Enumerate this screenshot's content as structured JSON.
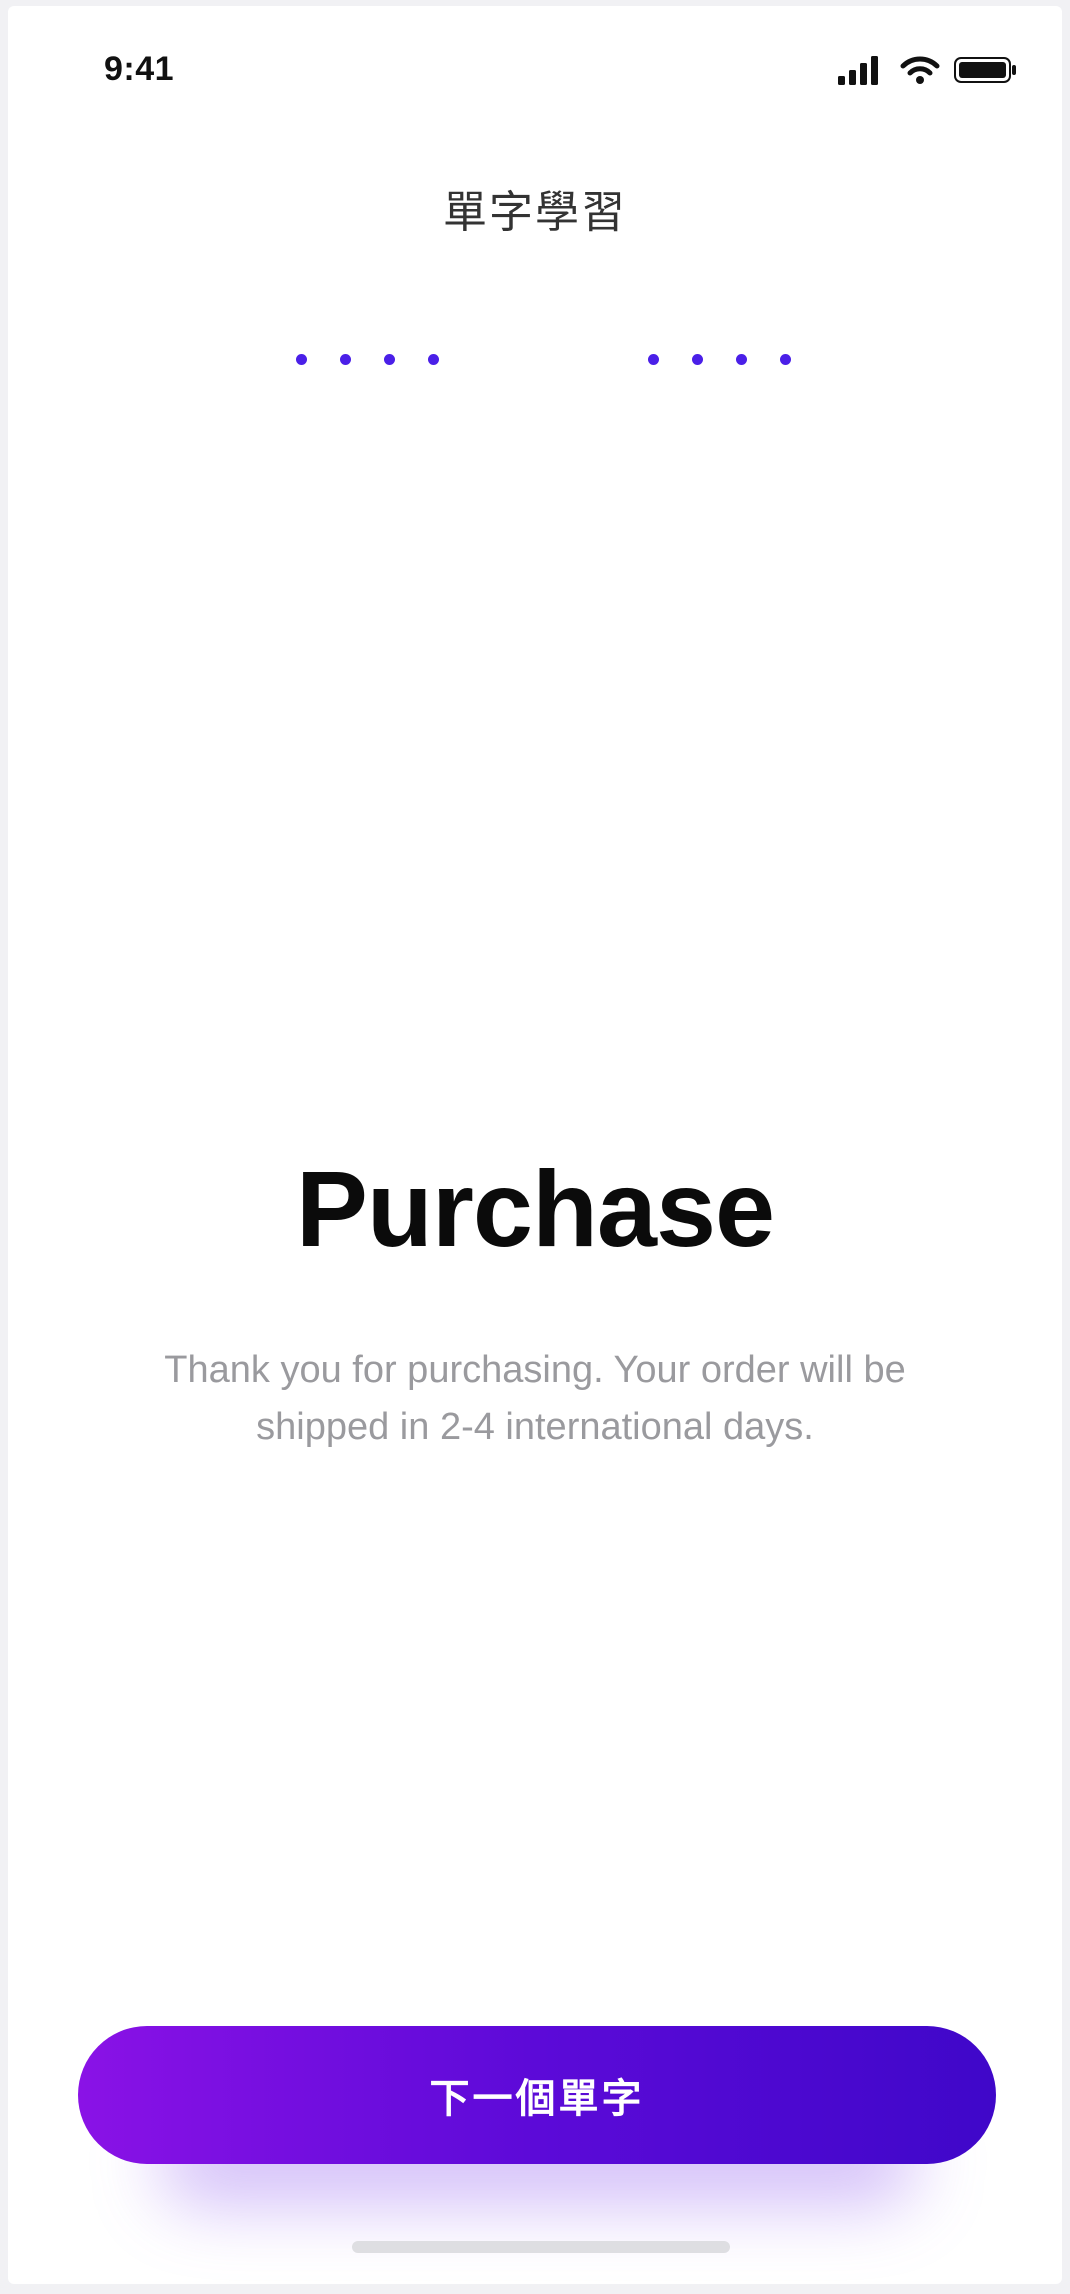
{
  "status_bar": {
    "time": "9:41",
    "icons": [
      "cellular-signal-icon",
      "wifi-icon",
      "battery-icon"
    ]
  },
  "header": {
    "title": "單字學習"
  },
  "progress": {
    "left_dots": 4,
    "right_dots": 4,
    "color": "#4a1fe8"
  },
  "main": {
    "title": "Purchase",
    "subtitle": "Thank you for purchasing. Your order will be shipped in 2-4 international days."
  },
  "button": {
    "label": "下一個單字",
    "gradient_start": "#8a12e6",
    "gradient_end": "#3f07c9"
  }
}
